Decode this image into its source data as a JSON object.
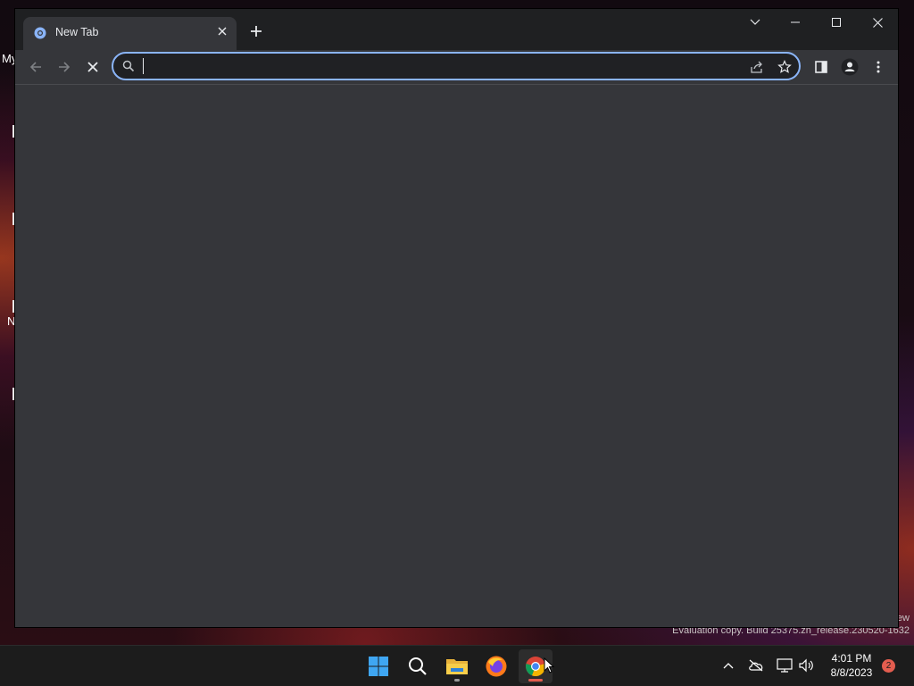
{
  "desktop": {
    "labels": [
      "My",
      "N"
    ],
    "watermark": "Evaluation copy. Build 25375.zn_release.230520-1632",
    "watermark_edge": "ew"
  },
  "browser": {
    "tab": {
      "title": "New Tab",
      "favicon": "chrome-newtab-icon",
      "close_icon": "close-icon"
    },
    "new_tab_icon": "plus-icon",
    "window_controls": [
      "tab-search-chevron",
      "minimize",
      "maximize",
      "close"
    ],
    "toolbar": {
      "back_icon": "back-arrow-icon",
      "forward_icon": "forward-arrow-icon",
      "stop_icon": "stop-loading-icon",
      "omnibox": {
        "value": "",
        "placeholder": "",
        "search_icon": "search-icon",
        "actions": [
          "share-icon",
          "bookmark-star-icon"
        ]
      },
      "side_panel_icon": "side-panel-icon",
      "profile_icon": "profile-icon",
      "menu_icon": "kebab-menu-icon"
    }
  },
  "taskbar": {
    "apps": [
      "windows-start-icon",
      "search-icon",
      "file-explorer-icon",
      "firefox-icon",
      "chrome-icon"
    ],
    "tray": [
      "chevron-up-icon",
      "onedrive-icon",
      "network-icon",
      "volume-icon"
    ],
    "clock": {
      "time": "4:01 PM",
      "date": "8/8/2023"
    },
    "notifications": "2"
  },
  "colors": {
    "accent": "#8ab4f8",
    "tab_strip": "#1f2022",
    "toolbar": "#35363a",
    "taskbar": "#1c1c1c",
    "badge": "#e35d4f"
  }
}
